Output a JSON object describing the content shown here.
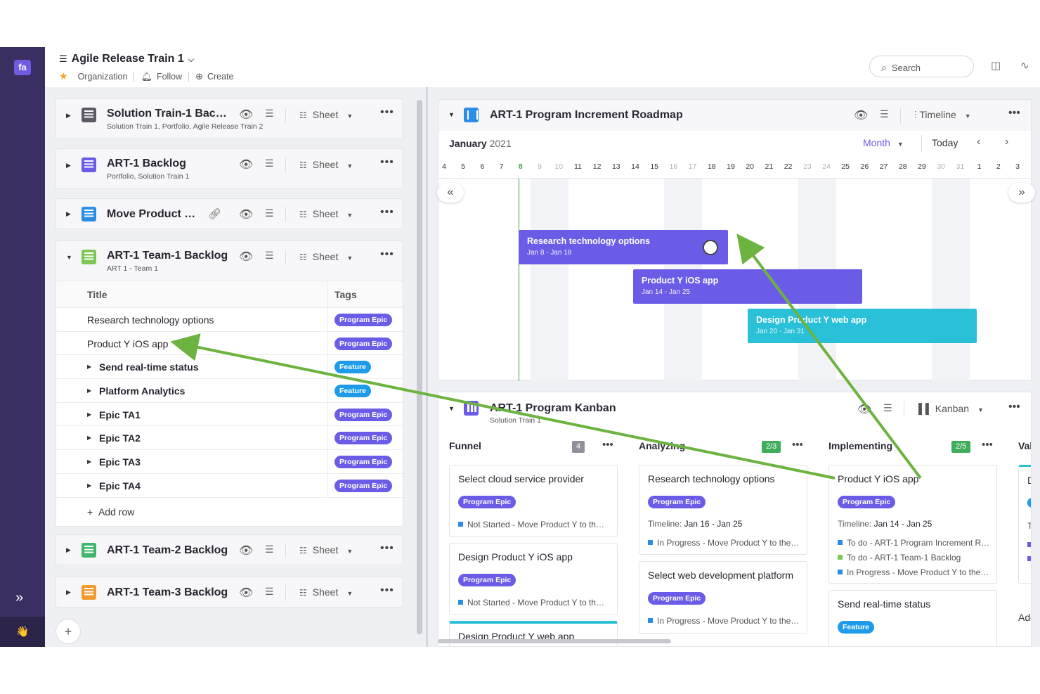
{
  "header": {
    "title": "Agile Release Train 1",
    "organization": "Organization",
    "follow": "Follow",
    "create": "Create",
    "search_placeholder": "Search"
  },
  "left_panels": [
    {
      "title": "Solution Train-1 Bac…",
      "subtitle": "Solution Train 1, Portfolio, Agile Release Train 2",
      "view": "Sheet",
      "color": "#5b5b66"
    },
    {
      "title": "ART-1 Backlog",
      "subtitle": "Portfolio, Solution Train 1",
      "view": "Sheet",
      "color": "#6b5ce7"
    },
    {
      "title": "Move Product …",
      "subtitle": "",
      "view": "Sheet",
      "color": "#2b8de6"
    },
    {
      "title": "ART-1 Team-1 Backlog",
      "subtitle": "ART 1 - Team 1",
      "view": "Sheet",
      "color": "#7dc855"
    },
    {
      "title": "ART-1 Team-2 Backlog",
      "subtitle": "",
      "view": "Sheet",
      "color": "#3fb66b"
    },
    {
      "title": "ART-1 Team-3 Backlog",
      "subtitle": "",
      "view": "Sheet",
      "color": "#f29a2e"
    }
  ],
  "team1_table": {
    "col_title": "Title",
    "col_tags": "Tags",
    "rows": [
      {
        "title": "Research technology options",
        "tag": "Program Epic",
        "expandable": false
      },
      {
        "title": "Product Y iOS app",
        "tag": "Program Epic",
        "expandable": false
      },
      {
        "title": "Send real-time status",
        "tag": "Feature",
        "expandable": true
      },
      {
        "title": "Platform Analytics",
        "tag": "Feature",
        "expandable": true
      },
      {
        "title": "Epic TA1",
        "tag": "Program Epic",
        "expandable": true
      },
      {
        "title": "Epic TA2",
        "tag": "Program Epic",
        "expandable": true
      },
      {
        "title": "Epic TA3",
        "tag": "Program Epic",
        "expandable": true
      },
      {
        "title": "Epic TA4",
        "tag": "Program Epic",
        "expandable": true
      }
    ],
    "add_row": "Add row"
  },
  "roadmap": {
    "title": "ART-1 Program Increment Roadmap",
    "view": "Timeline",
    "month": "January",
    "year": "2021",
    "scale": "Month",
    "today": "Today",
    "days": [
      "4",
      "5",
      "6",
      "7",
      "8",
      "9",
      "10",
      "11",
      "12",
      "13",
      "14",
      "15",
      "16",
      "17",
      "18",
      "19",
      "20",
      "21",
      "22",
      "23",
      "24",
      "25",
      "26",
      "27",
      "28",
      "29",
      "30",
      "31",
      "1",
      "2",
      "3"
    ],
    "bars": [
      {
        "name": "Research technology options",
        "dates": "Jan 8 - Jan 18",
        "color": "#6b5ce7"
      },
      {
        "name": "Product Y iOS app",
        "dates": "Jan 14 - Jan 25",
        "color": "#6b5ce7"
      },
      {
        "name": "Design Product Y web app",
        "dates": "Jan 20 - Jan 31",
        "color": "#29c0d8"
      }
    ]
  },
  "kanban": {
    "title": "ART-1 Program Kanban",
    "subtitle": "Solution Train 1",
    "view": "Kanban",
    "columns": [
      {
        "name": "Funnel",
        "count": "4",
        "count_color": "#8f9099"
      },
      {
        "name": "Analyzing",
        "count": "2/3",
        "count_color": "#3fae5a"
      },
      {
        "name": "Implementing",
        "count": "2/5",
        "count_color": "#3fae5a"
      },
      {
        "name": "Val",
        "count": "",
        "count_color": ""
      }
    ],
    "funnel_cards": [
      {
        "title": "Select cloud service provider",
        "tag": "Program Epic",
        "line": "Not Started - Move Product Y to th…"
      },
      {
        "title": "Design Product Y iOS app",
        "tag": "Program Epic",
        "line": "Not Started - Move Product Y to th…"
      },
      {
        "title": "Design Product Y web app"
      }
    ],
    "analyzing_cards": [
      {
        "title": "Research technology options",
        "tag": "Program Epic",
        "timeline_label": "Timeline:",
        "timeline": "Jan 16 - Jan 25",
        "line": "In Progress - Move Product Y to the…"
      },
      {
        "title": "Select web development platform",
        "tag": "Program Epic",
        "line": "In Progress - Move Product Y to the…"
      }
    ],
    "implementing_cards": [
      {
        "title": "Product Y iOS app",
        "tag": "Program Epic",
        "timeline_label": "Timeline:",
        "timeline": "Jan 14 - Jan 25",
        "lines": [
          "To do - ART-1 Program Increment R…",
          "To do - ART-1 Team-1 Backlog",
          "In Progress - Move Product Y to the…"
        ]
      },
      {
        "title": "Send real-time status",
        "tag": "Feature"
      }
    ],
    "partial_col": {
      "letter_d": "D",
      "letter_t": "Ti",
      "add": "Add"
    }
  },
  "colors": {
    "epic": "#6b5ce7",
    "feature": "#1e9be9",
    "arrow": "#6db33f",
    "rail": "#3b2f62"
  }
}
